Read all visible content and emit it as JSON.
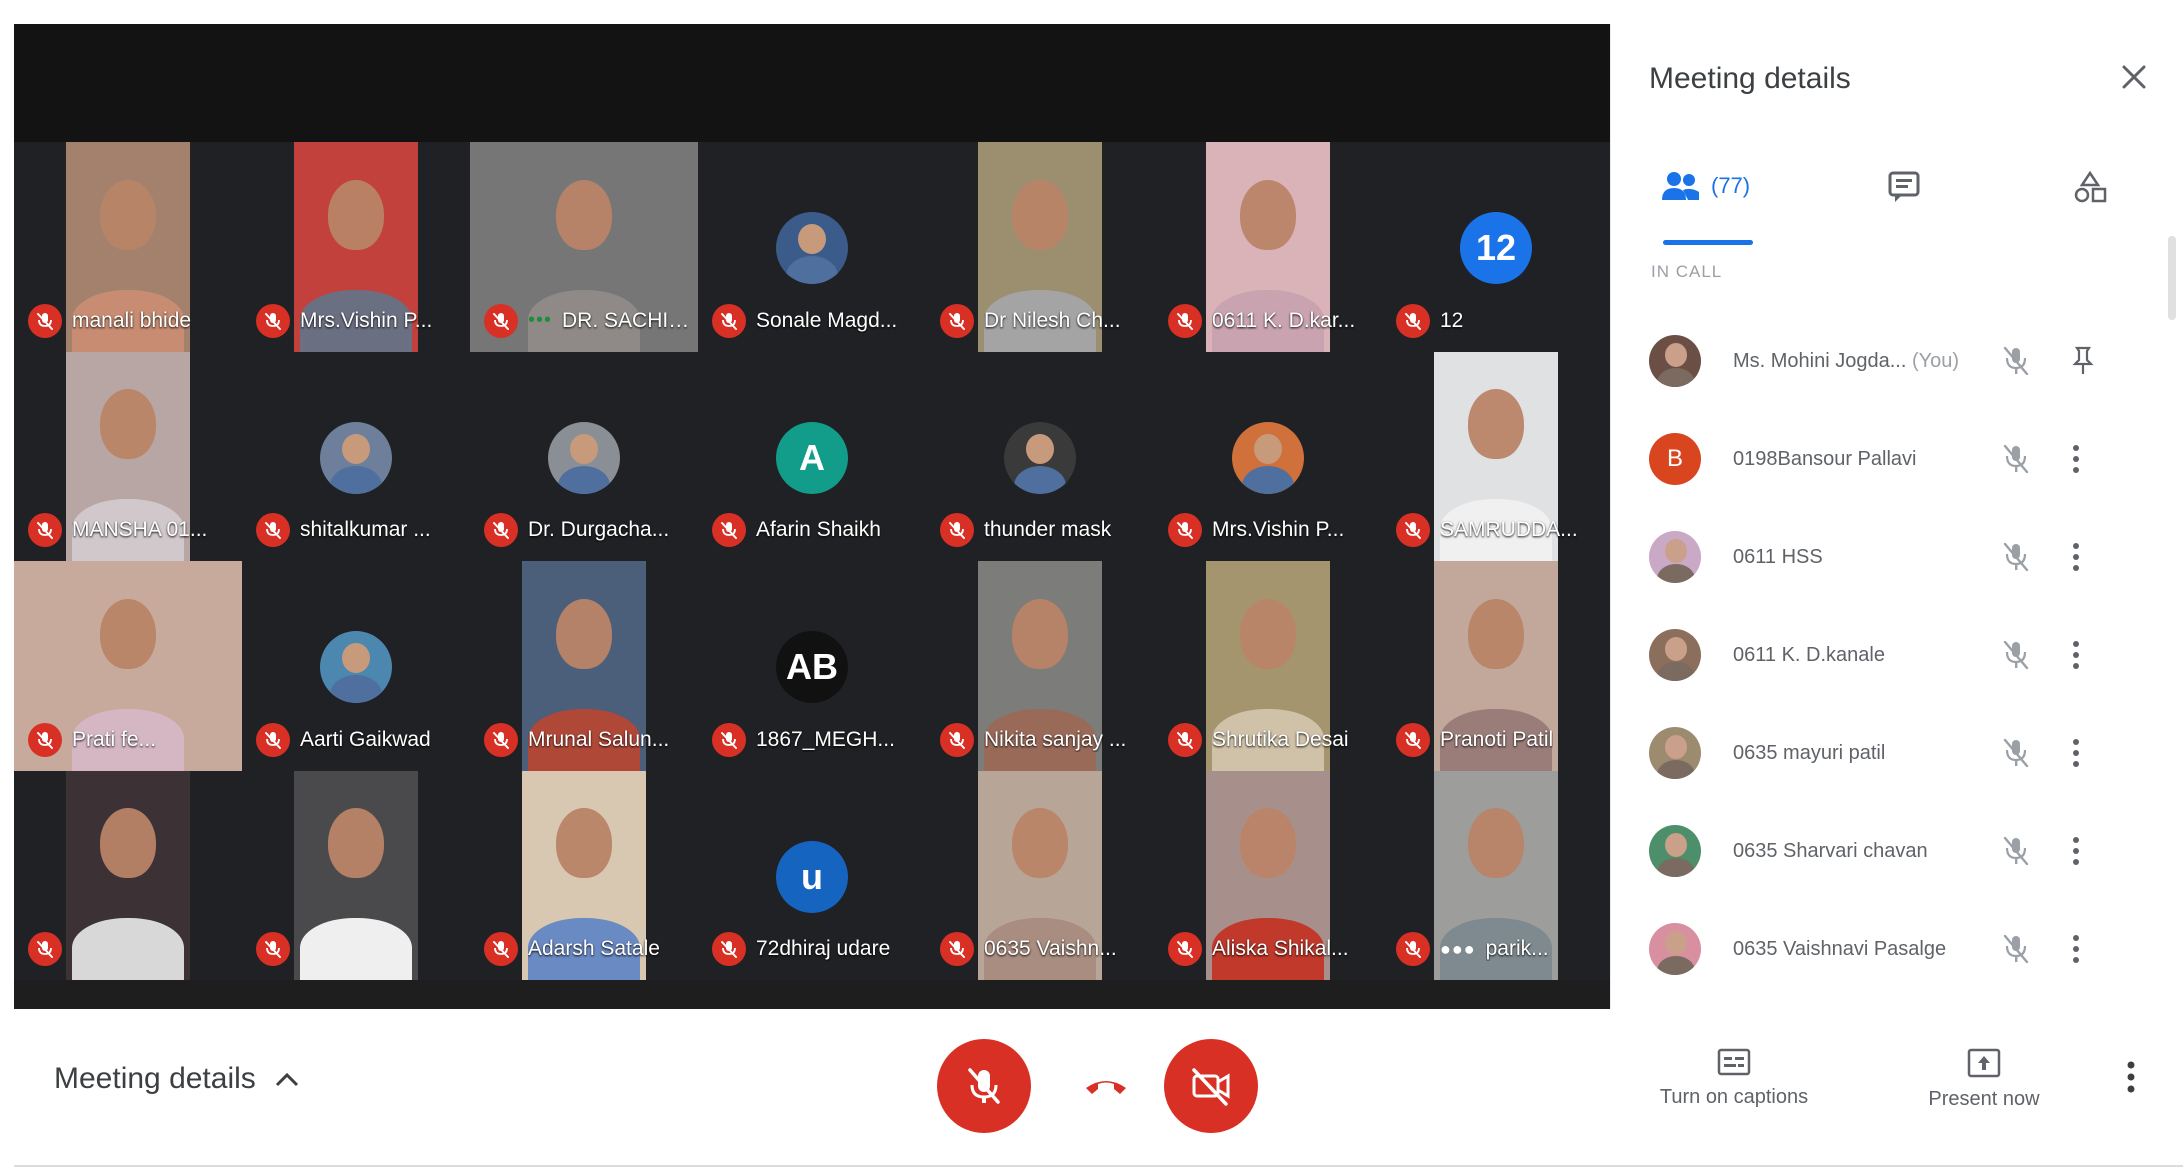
{
  "meeting": {
    "details_label": "Meeting details",
    "participants": [
      {
        "name": "manali bhide",
        "kind": "video",
        "bg": "#a3816d",
        "shirt": "#c78c72"
      },
      {
        "name": "Mrs.Vishin P...",
        "kind": "video",
        "bg": "#c2413c",
        "shirt": "#6a6f82"
      },
      {
        "name": "DR. SACHIN...",
        "kind": "video-wide",
        "bg": "#767676",
        "shirt": "#8f8a88",
        "talking": true
      },
      {
        "name": "Sonale Magd...",
        "kind": "avatar-photo",
        "bg": "#3b5b8a"
      },
      {
        "name": "Dr Nilesh Ch...",
        "kind": "video",
        "bg": "#9c8f70",
        "shirt": "#a4a4a4"
      },
      {
        "name": "0611 K. D.kar...",
        "kind": "video",
        "bg": "#d9b3b8",
        "shirt": "#c9a3b0"
      },
      {
        "name": "12",
        "kind": "avatar-letter",
        "letter": "12",
        "bg": "#1a73e8"
      },
      {
        "name": "MANSHA 01...",
        "kind": "video",
        "bg": "#b7a6a3",
        "shirt": "#d1c8cc"
      },
      {
        "name": "shitalkumar ...",
        "kind": "avatar-photo",
        "bg": "#6d7f9b"
      },
      {
        "name": "Dr. Durgacha...",
        "kind": "avatar-photo",
        "bg": "#8a8f95"
      },
      {
        "name": "Afarin Shaikh",
        "kind": "avatar-letter",
        "letter": "A",
        "bg": "#129c8a"
      },
      {
        "name": "thunder mask",
        "kind": "avatar-photo",
        "bg": "#3a3a3a"
      },
      {
        "name": "Mrs.Vishin P...",
        "kind": "avatar-photo",
        "bg": "#d0703a"
      },
      {
        "name": "SAMRUDDA...",
        "kind": "video",
        "bg": "#dfe1e3",
        "shirt": "#f0f0f0"
      },
      {
        "name": "Prati fe...",
        "kind": "video-wide",
        "bg": "#c8aa9d",
        "shirt": "#d5b7c4"
      },
      {
        "name": "Aarti Gaikwad",
        "kind": "avatar-photo",
        "bg": "#4c87b0"
      },
      {
        "name": "Mrunal Salun...",
        "kind": "video",
        "bg": "#4b5e7a",
        "shirt": "#b04838"
      },
      {
        "name": "1867_MEGH...",
        "kind": "avatar-letter",
        "letter": "AB",
        "bg": "#111111"
      },
      {
        "name": "Nikita sanjay ...",
        "kind": "video",
        "bg": "#7c7c7a",
        "shirt": "#9a6a58"
      },
      {
        "name": "Shrutika Desai",
        "kind": "video",
        "bg": "#a4956e",
        "shirt": "#d0c2a8"
      },
      {
        "name": "Pranoti Patil",
        "kind": "video",
        "bg": "#c2a79b",
        "shirt": "#9a7d79"
      },
      {
        "name": "",
        "kind": "video",
        "bg": "#3c3134",
        "shirt": "#d8d8d8"
      },
      {
        "name": "",
        "kind": "video",
        "bg": "#4a4a4d",
        "shirt": "#efefef"
      },
      {
        "name": "Adarsh Satale",
        "kind": "video",
        "bg": "#d8c7b1",
        "shirt": "#6a8ac4"
      },
      {
        "name": "72dhiraj udare",
        "kind": "avatar-letter",
        "letter": "u",
        "bg": "#1565c0"
      },
      {
        "name": "0635 Vaishn...",
        "kind": "video",
        "bg": "#b7a597",
        "shirt": "#a88d80"
      },
      {
        "name": "Aliska Shikal...",
        "kind": "video",
        "bg": "#a7908c",
        "shirt": "#c0392b"
      },
      {
        "name": "parik...",
        "kind": "video",
        "bg": "#9d9e9c",
        "shirt": "#7e8a8f",
        "dots": true
      }
    ]
  },
  "controls": {
    "captions_label": "Turn on captions",
    "present_label": "Present now"
  },
  "panel": {
    "title": "Meeting details",
    "people_count": "(77)",
    "section_label": "IN CALL",
    "people": [
      {
        "name": "Ms. Mohini Jogda...",
        "suffix": "(You)",
        "avatar": "photo",
        "color": "#6b4f44",
        "action": "pin"
      },
      {
        "name": "0198Bansour Pallavi",
        "avatar": "letter",
        "letter": "B",
        "color": "#d9451f",
        "action": "more"
      },
      {
        "name": "0611 HSS",
        "avatar": "photo",
        "color": "#c9a9c6",
        "action": "more"
      },
      {
        "name": "0611 K. D.kanale",
        "avatar": "photo",
        "color": "#8c6e5c",
        "action": "more"
      },
      {
        "name": "0635 mayuri patil",
        "avatar": "photo",
        "color": "#9c8b6f",
        "action": "more"
      },
      {
        "name": "0635 Sharvari chavan",
        "avatar": "photo",
        "color": "#4c8f6a",
        "action": "more"
      },
      {
        "name": "0635 Vaishnavi Pasalge",
        "avatar": "photo",
        "color": "#d88fa0",
        "action": "more"
      }
    ]
  },
  "colors": {
    "accent": "#1a73e8",
    "danger": "#d93025",
    "stage": "#1e1e1f"
  }
}
